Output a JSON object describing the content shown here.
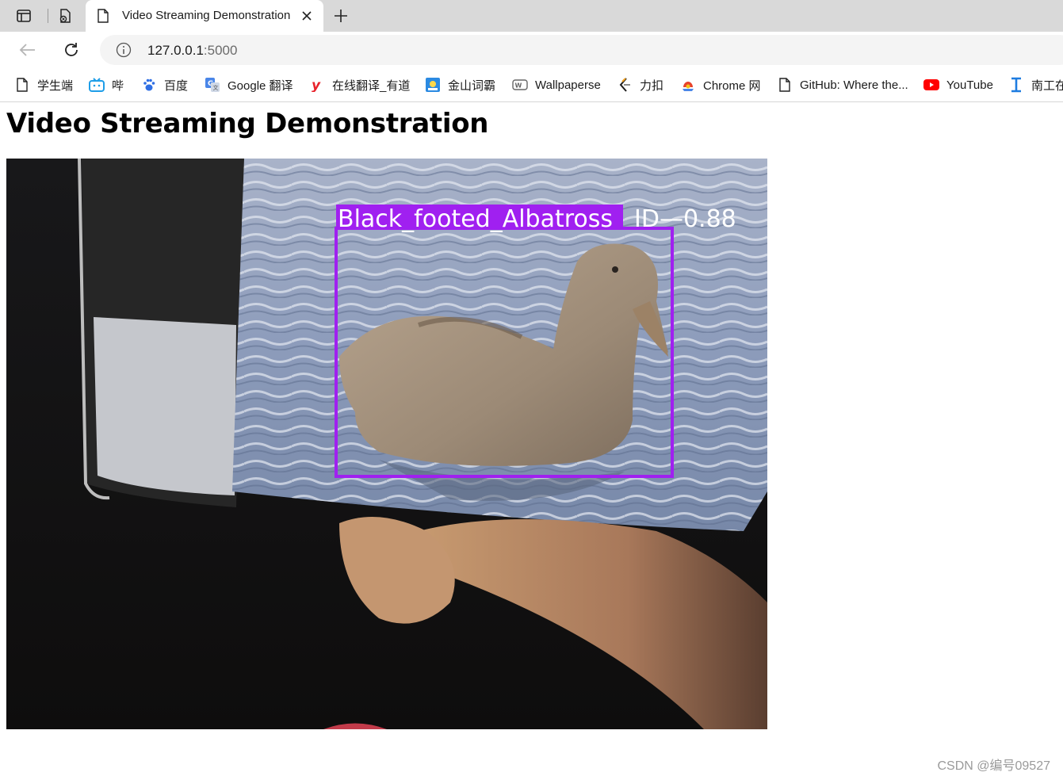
{
  "browser": {
    "tab_title": "Video Streaming Demonstration",
    "url_host": "127.0.0.1",
    "url_port": ":5000",
    "bookmarks": [
      {
        "label": "学生端",
        "icon": "page-icon"
      },
      {
        "label": "哔",
        "icon": "bilibili-icon"
      },
      {
        "label": "百度",
        "icon": "baidu-paw-icon"
      },
      {
        "label": "Google 翻译",
        "icon": "google-translate-icon"
      },
      {
        "label": "在线翻译_有道",
        "icon": "youdao-icon"
      },
      {
        "label": "金山词霸",
        "icon": "kingsoft-ciba-icon"
      },
      {
        "label": "Wallpaperse",
        "icon": "wallpaper-icon"
      },
      {
        "label": "力扣",
        "icon": "leetcode-icon"
      },
      {
        "label": "Chrome 网",
        "icon": "chrome-store-icon"
      },
      {
        "label": "GitHub: Where the...",
        "icon": "page-icon"
      },
      {
        "label": "YouTube",
        "icon": "youtube-icon"
      },
      {
        "label": "南工在",
        "icon": "text-cursor-icon"
      }
    ]
  },
  "page": {
    "title": "Video Streaming Demonstration",
    "video": {
      "detection_label": "Black_footed_Albatross",
      "detection_id_score": "ID—0.88",
      "box_color": "#a020f0"
    }
  },
  "watermark": "CSDN @编号09527"
}
